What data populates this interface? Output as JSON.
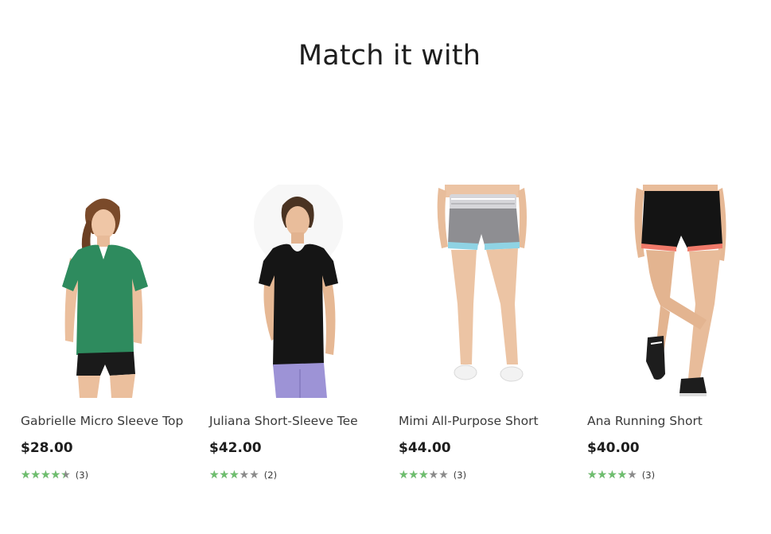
{
  "section": {
    "title": "Match it with"
  },
  "products": [
    {
      "name": "Gabrielle Micro Sleeve Top",
      "price": "$28.00",
      "rating_fraction": 0.87,
      "review_count": "(3)",
      "image_icon": "woman-green-tee-photo",
      "colors": {
        "garment": "#2e8b5e",
        "bottom": "#1a1a1a"
      }
    },
    {
      "name": "Juliana Short-Sleeve Tee",
      "price": "$42.00",
      "rating_fraction": 0.6,
      "review_count": "(2)",
      "image_icon": "woman-black-tee-photo",
      "colors": {
        "garment": "#151515",
        "bottom": "#9d93d6"
      }
    },
    {
      "name": "Mimi All-Purpose Short",
      "price": "$44.00",
      "rating_fraction": 0.6,
      "review_count": "(3)",
      "image_icon": "gray-shorts-photo",
      "colors": {
        "garment": "#8e8e92",
        "trim": "#8fd3e4"
      }
    },
    {
      "name": "Ana Running Short",
      "price": "$40.00",
      "rating_fraction": 0.8,
      "review_count": "(3)",
      "image_icon": "black-shorts-photo",
      "colors": {
        "garment": "#141414",
        "trim": "#f07a6a"
      }
    }
  ],
  "rating_colors": {
    "filled": "#6dbf6d",
    "empty": "#8a8a8a"
  },
  "star_glyphs": "★★★★★"
}
